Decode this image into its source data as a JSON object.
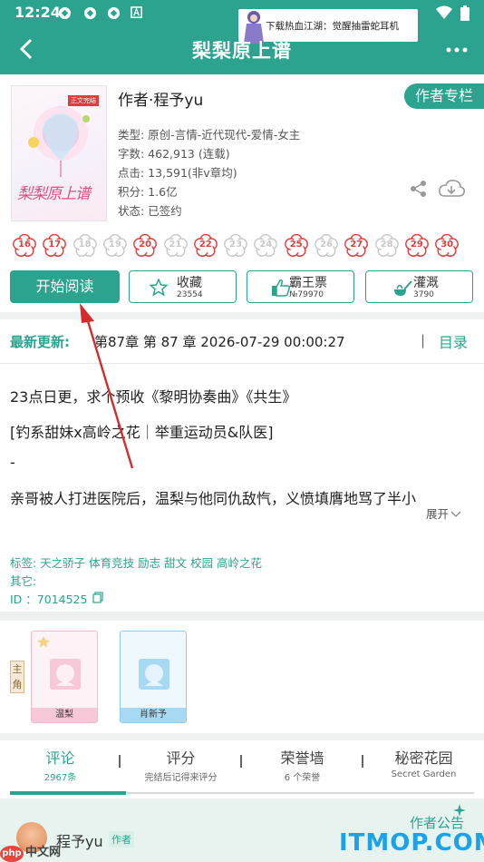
{
  "status_bar": {
    "time": "12:24",
    "icons": [
      "notification-icon",
      "notification-icon",
      "notification-icon",
      "a-icon",
      "wifi-icon",
      "battery-icon"
    ]
  },
  "ad": {
    "text": "下载热血江湖：觉醒抽雷蛇耳机"
  },
  "app_bar": {
    "title": "梨梨原上谱",
    "back_icon": "back-arrow-icon",
    "more_icon": "more-icon"
  },
  "book": {
    "cover_tag": "正文完结",
    "cover_title": "梨梨原上谱",
    "author": "作者·程予yu",
    "author_column": "作者专栏",
    "type": "类型: 原创-言情-近代现代-爱情-女主",
    "words": "字数: 462,913 (连载)",
    "clicks": "点击: 13,591(非v章均)",
    "points": "积分: 1.6亿",
    "status": "状态: 已签约"
  },
  "dates": [
    "16",
    "17",
    "18",
    "19",
    "20",
    "21",
    "22",
    "23",
    "24",
    "25",
    "26",
    "27",
    "28",
    "29",
    "30"
  ],
  "dates_active": [
    true,
    true,
    false,
    false,
    true,
    false,
    true,
    false,
    false,
    true,
    false,
    true,
    false,
    true,
    true
  ],
  "colors": {
    "accent": "#2ba38e",
    "date_active": "#e23b3b",
    "date_inactive": "#c8c8c8"
  },
  "buttons": {
    "read": "开始阅读",
    "favorite": {
      "label": "收藏",
      "count": "23554"
    },
    "ticket": {
      "label": "霸王票",
      "count": "№79970"
    },
    "water": {
      "label": "灌溉",
      "count": "3790"
    }
  },
  "update": {
    "label": "最新更新:",
    "text": "第87章  第 87 章  2026-07-29 00:00:27",
    "separator": "|",
    "toc": "目录"
  },
  "intro": {
    "line1": "23点日更，求个预收《黎明协奏曲》《共生》",
    "line2": "[钓系甜妹x高岭之花｜举重运动员&队医]",
    "line3": "-",
    "line4": "亲哥被人打进医院后，温梨与他同仇敌忾，义愤填膺地骂了半小",
    "expand": "展开"
  },
  "tags": "标签: 天之骄子 体育竞技 励志 甜文 校园 高岭之花",
  "other": "其它:",
  "id_line": "ID  ：7014525",
  "characters": {
    "role_tag": "主角",
    "items": [
      {
        "name": "温梨",
        "color": "#f4a7c0"
      },
      {
        "name": "肖新予",
        "color": "#7cc4ea"
      }
    ]
  },
  "tabs": [
    {
      "label": "评论",
      "sub": "2967条"
    },
    {
      "label": "评分",
      "sub": "完结后记得来评分"
    },
    {
      "label": "荣誉墙",
      "sub": "6 个荣誉"
    },
    {
      "label": "秘密花园",
      "sub": "Secret Garden"
    }
  ],
  "bottom": {
    "author_name": "程予yu",
    "author_badge": "作者",
    "notice": "作者公告",
    "watermark_left": "中文网",
    "watermark_left_badge": "php",
    "watermark_right": "ITMOP.COM"
  }
}
